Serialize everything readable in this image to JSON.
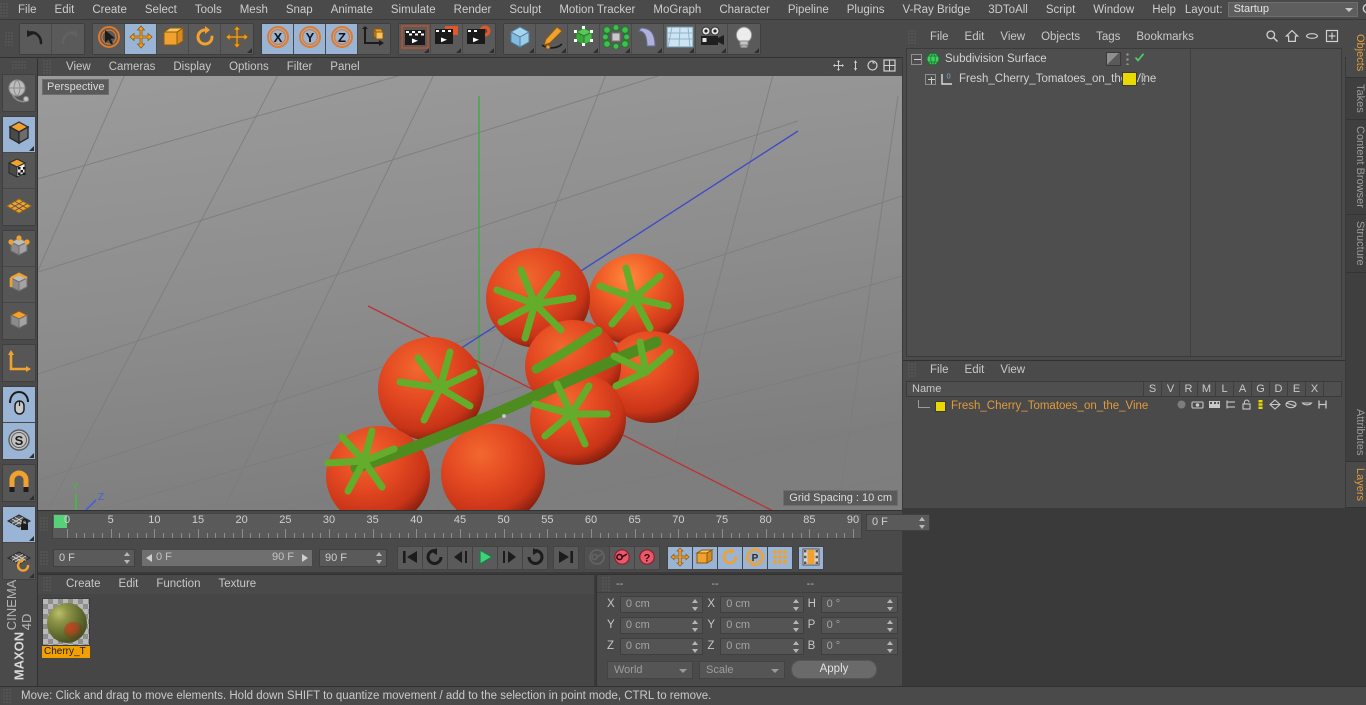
{
  "app": {
    "brand_line1": "MAXON",
    "brand_line2": "CINEMA 4D"
  },
  "menubar": {
    "items": [
      "File",
      "Edit",
      "Create",
      "Select",
      "Tools",
      "Mesh",
      "Snap",
      "Animate",
      "Simulate",
      "Render",
      "Sculpt",
      "Motion Tracker",
      "MoGraph",
      "Character",
      "Pipeline",
      "Plugins",
      "V-Ray Bridge",
      "3DToAll",
      "Script",
      "Window",
      "Help"
    ],
    "layout_label": "Layout:",
    "layout_value": "Startup",
    "right_icons": [
      "search-icon",
      "home-icon",
      "minimize-icon",
      "maximize-icon"
    ]
  },
  "toolbar": {
    "groups": [
      {
        "name": "history",
        "buttons": [
          {
            "icon": "undo-icon",
            "active": false,
            "disabled": false
          },
          {
            "icon": "redo-icon",
            "active": false,
            "disabled": true
          }
        ]
      },
      {
        "name": "transform",
        "buttons": [
          {
            "icon": "live-selection-icon",
            "active": false,
            "disabled": false
          },
          {
            "icon": "move-icon",
            "active": true,
            "disabled": false
          },
          {
            "icon": "scale-icon",
            "active": false,
            "disabled": false
          },
          {
            "icon": "rotate-icon",
            "active": false,
            "disabled": false
          },
          {
            "icon": "move-alt-icon",
            "active": false,
            "disabled": false
          }
        ]
      },
      {
        "name": "axis-lock",
        "buttons": [
          {
            "icon": "axis-x-icon",
            "active": true,
            "disabled": false
          },
          {
            "icon": "axis-y-icon",
            "active": true,
            "disabled": false
          },
          {
            "icon": "axis-z-icon",
            "active": true,
            "disabled": false
          },
          {
            "icon": "world-coordinate-icon",
            "active": false,
            "disabled": false
          }
        ]
      },
      {
        "name": "render",
        "buttons": [
          {
            "icon": "render-view-icon",
            "active": false,
            "disabled": false
          },
          {
            "icon": "render-region-icon",
            "active": false,
            "disabled": false
          },
          {
            "icon": "render-settings-icon",
            "active": false,
            "disabled": false
          }
        ]
      },
      {
        "name": "objects",
        "buttons": [
          {
            "icon": "cube-primitive-icon",
            "active": false,
            "disabled": false
          },
          {
            "icon": "spline-pen-icon",
            "active": false,
            "disabled": false
          },
          {
            "icon": "generator-nurbs-icon",
            "active": false,
            "disabled": false
          },
          {
            "icon": "mograph-cloner-icon",
            "active": false,
            "disabled": false
          },
          {
            "icon": "deformer-bend-icon",
            "active": false,
            "disabled": false
          },
          {
            "icon": "environment-floor-icon",
            "active": false,
            "disabled": false
          },
          {
            "icon": "camera-icon",
            "active": false,
            "disabled": false
          },
          {
            "icon": "light-icon",
            "active": false,
            "disabled": false
          }
        ]
      }
    ]
  },
  "left_palette": {
    "groups": [
      {
        "buttons": [
          {
            "icon": "make-editable-icon",
            "active": false
          }
        ]
      },
      {
        "buttons": [
          {
            "icon": "model-mode-icon",
            "active": true
          },
          {
            "icon": "texture-mode-icon",
            "active": false
          },
          {
            "icon": "workplane-mode-icon",
            "active": false
          }
        ]
      },
      {
        "buttons": [
          {
            "icon": "points-mode-icon",
            "active": false
          },
          {
            "icon": "edges-mode-icon",
            "active": false
          },
          {
            "icon": "polygons-mode-icon",
            "active": false
          }
        ]
      },
      {
        "buttons": [
          {
            "icon": "axis-modify-icon",
            "active": false
          }
        ]
      },
      {
        "buttons": [
          {
            "icon": "viewport-solo-icon",
            "active": true
          },
          {
            "icon": "enable-axis-icon",
            "active": true
          }
        ]
      },
      {
        "buttons": [
          {
            "icon": "snap-magnet-icon",
            "active": false
          }
        ]
      },
      {
        "buttons": [
          {
            "icon": "workplane-lock-icon",
            "active": true
          },
          {
            "icon": "workplane-rotate-icon",
            "active": false
          }
        ]
      }
    ]
  },
  "viewport": {
    "menu": [
      "View",
      "Cameras",
      "Display",
      "Options",
      "Filter",
      "Panel"
    ],
    "view_label": "Perspective",
    "grid_label": "Grid Spacing : 10 cm",
    "axis_labels": {
      "x": "X",
      "y": "Y",
      "z": "Z"
    },
    "right_icons": [
      "pan-icon",
      "zoom-icon",
      "rotate-view-icon",
      "maximize-view-icon"
    ],
    "scene_description": "Cluster of cherry tomatoes on the vine"
  },
  "timeline": {
    "frame_numbers": [
      "0",
      "5",
      "10",
      "15",
      "20",
      "25",
      "30",
      "35",
      "40",
      "45",
      "50",
      "55",
      "60",
      "65",
      "70",
      "75",
      "80",
      "85",
      "90"
    ],
    "current_frame_field": "0 F",
    "start_field": "0 F",
    "range_start": "0 F",
    "range_end": "90 F",
    "end_field": "90 F",
    "playback_buttons": [
      {
        "icon": "goto-start-icon",
        "active": false,
        "disabled": false
      },
      {
        "icon": "play-reverse-loop-icon",
        "active": false,
        "disabled": false
      },
      {
        "icon": "step-back-icon",
        "active": false,
        "disabled": false
      },
      {
        "icon": "play-icon",
        "active": false,
        "disabled": false
      },
      {
        "icon": "step-forward-icon",
        "active": false,
        "disabled": false
      },
      {
        "icon": "play-loop-icon",
        "active": false,
        "disabled": false
      },
      {
        "icon": "goto-end-icon",
        "active": false,
        "disabled": false
      },
      {
        "icon": "record-key-icon",
        "active": false,
        "disabled": true
      },
      {
        "icon": "autokey-icon",
        "active": false,
        "disabled": false
      },
      {
        "icon": "keyframe-selection-icon",
        "active": false,
        "disabled": false
      },
      {
        "icon": "key-position-icon",
        "active": true,
        "disabled": false
      },
      {
        "icon": "key-scale-icon",
        "active": true,
        "disabled": false
      },
      {
        "icon": "key-rotation-icon",
        "active": true,
        "disabled": false
      },
      {
        "icon": "key-parameter-icon",
        "active": true,
        "disabled": false
      },
      {
        "icon": "key-pla-icon",
        "active": true,
        "disabled": false
      },
      {
        "icon": "timeline-view-icon",
        "active": true,
        "disabled": false
      }
    ]
  },
  "material_manager": {
    "menu": [
      "Create",
      "Edit",
      "Function",
      "Texture"
    ],
    "materials": [
      {
        "name": "Cherry_T"
      }
    ]
  },
  "coordinates": {
    "headers": [
      "--",
      "--",
      "--"
    ],
    "rows": [
      {
        "l1": "X",
        "v1": "0 cm",
        "l2": "X",
        "v2": "0 cm",
        "l3": "H",
        "v3": "0 °"
      },
      {
        "l1": "Y",
        "v1": "0 cm",
        "l2": "Y",
        "v2": "0 cm",
        "l3": "P",
        "v3": "0 °"
      },
      {
        "l1": "Z",
        "v1": "0 cm",
        "l2": "Z",
        "v2": "0 cm",
        "l3": "B",
        "v3": "0 °"
      }
    ],
    "system_value": "World",
    "mode_value": "Scale",
    "apply_label": "Apply"
  },
  "object_manager": {
    "menu": [
      "File",
      "Edit",
      "View",
      "Objects",
      "Tags",
      "Bookmarks"
    ],
    "right_icons": [
      "search-icon",
      "home-icon",
      "ellipse-icon",
      "add-layer-icon"
    ],
    "items": [
      {
        "name": "Subdivision Surface",
        "icon": "subdivision-surface-icon",
        "indent": 0,
        "expander": "minus",
        "tag_color": "",
        "has_check": true
      },
      {
        "name": "Fresh_Cherry_Tomatoes_on_the_Vine",
        "icon": "null-object-icon",
        "indent": 1,
        "expander": "plus",
        "tag_color": "#e8d900",
        "has_check": false
      }
    ]
  },
  "layer_manager": {
    "menu": [
      "File",
      "Edit",
      "View"
    ],
    "columns": [
      "Name",
      "S",
      "V",
      "R",
      "M",
      "L",
      "A",
      "G",
      "D",
      "E",
      "X"
    ],
    "rows": [
      {
        "name": "Fresh_Cherry_Tomatoes_on_the_Vine",
        "color": "#e8d900"
      }
    ]
  },
  "side_tabs": {
    "top": [
      {
        "label": "Objects",
        "active": true
      },
      {
        "label": "Takes",
        "active": false
      },
      {
        "label": "Content Browser",
        "active": false
      },
      {
        "label": "Structure",
        "active": false
      }
    ],
    "bottom": [
      {
        "label": "Attributes",
        "active": false
      },
      {
        "label": "Layers",
        "active": true
      }
    ]
  },
  "statusbar": {
    "text": "Move: Click and drag to move elements. Hold down SHIFT to quantize movement / add to the selection in point mode, CTRL to remove."
  },
  "colors": {
    "panel": "#4a4a4a",
    "accent_orange": "#e09a3c",
    "active_blue": "#9ab4d6",
    "viewport_bg": "#898989",
    "tomato_red": "#e03c20",
    "stem_green": "#5da026"
  }
}
